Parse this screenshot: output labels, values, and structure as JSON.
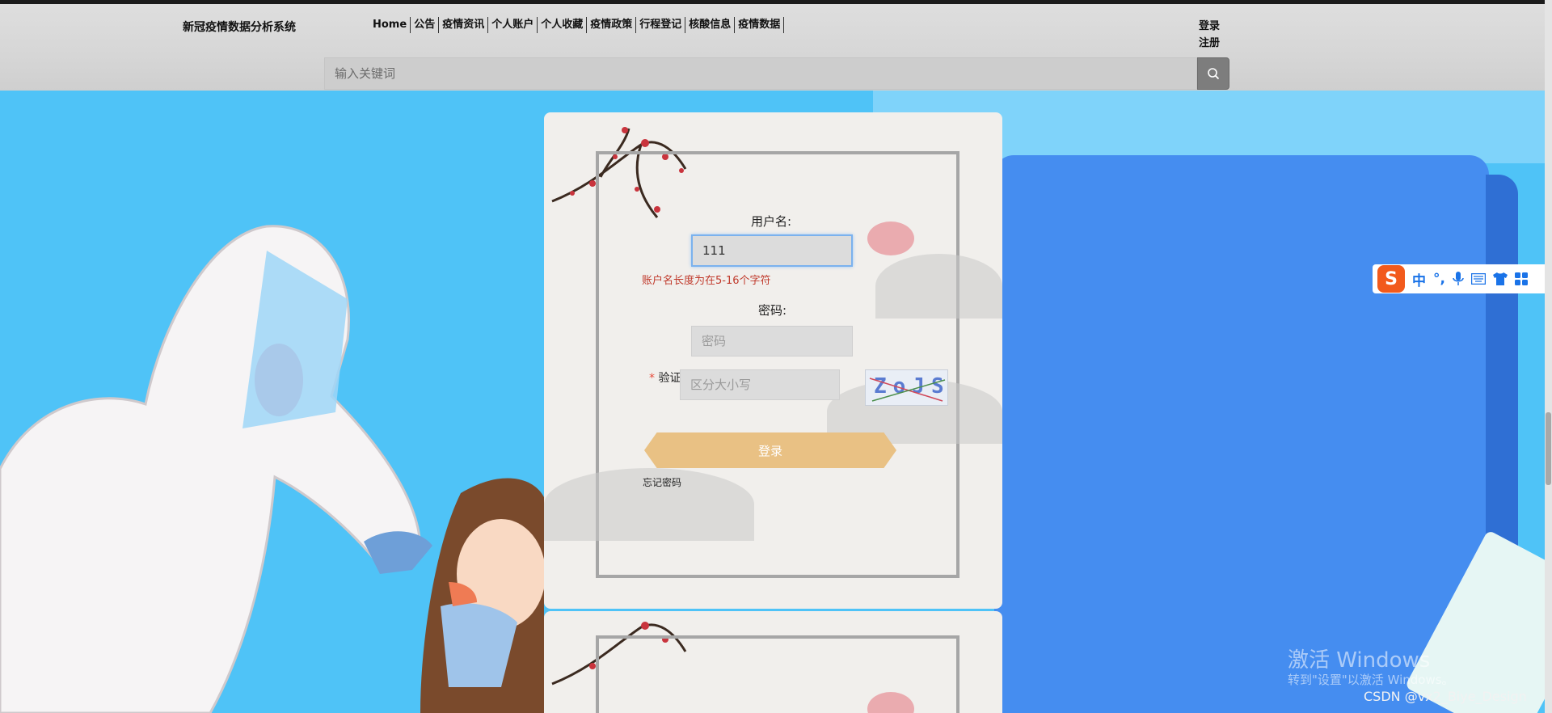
{
  "header": {
    "brand": "新冠疫情数据分析系统",
    "nav": [
      "Home",
      "公告",
      "疫情资讯",
      "个人账户",
      "个人收藏",
      "疫情政策",
      "行程登记",
      "核酸信息",
      "疫情数据"
    ],
    "login": "登录",
    "register": "注册",
    "search_placeholder": "输入关键词"
  },
  "login_form": {
    "username_label": "用户名:",
    "username_value": "111",
    "username_error": "账户名长度为在5-16个字符",
    "password_label": "密码:",
    "password_placeholder": "密码",
    "captcha_label": "验证",
    "captcha_required_mark": "*",
    "captcha_placeholder": "区分大小写",
    "captcha_text": "ZoJS",
    "submit_label": "登录",
    "forgot_label": "忘记密码"
  },
  "ime_toolbar": {
    "logo": "S",
    "mode": "中",
    "punct": "°,"
  },
  "os_watermark": {
    "line1": "激活 Windows",
    "line2": "转到\"设置\"以激活 Windows。"
  },
  "source_credit": "CSDN @vx2_Biye_Design",
  "colors": {
    "background_sky": "#4fc3f7",
    "book_blue": "#458df0",
    "login_button": "#e9c184",
    "error_text": "#c0392b"
  }
}
